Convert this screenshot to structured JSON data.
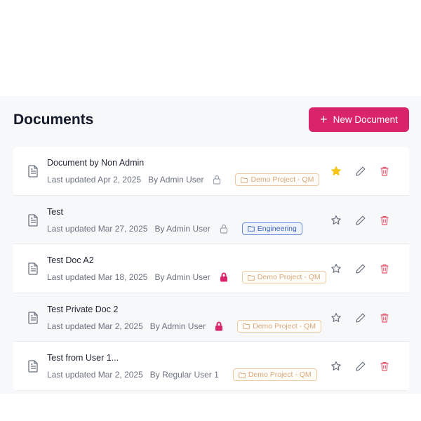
{
  "header": {
    "title": "Documents",
    "new_button_label": "New Document"
  },
  "colors": {
    "brand": "#d9246b",
    "star_active": "#f5c518",
    "delete": "#e5566f"
  },
  "documents": [
    {
      "title": "Document by Non Admin",
      "updated": "Last updated Apr 2, 2025",
      "author": "By Admin User",
      "lock": "outline",
      "project": "Demo Project - QM",
      "tag_style": "orange",
      "starred": true
    },
    {
      "title": "Test",
      "updated": "Last updated Mar 27, 2025",
      "author": "By Admin User",
      "lock": "outline",
      "project": "Engineering",
      "tag_style": "blue",
      "starred": false
    },
    {
      "title": "Test Doc A2",
      "updated": "Last updated Mar 18, 2025",
      "author": "By Admin User",
      "lock": "filled",
      "project": "Demo Project - QM",
      "tag_style": "orange",
      "starred": false
    },
    {
      "title": "Test Private Doc 2",
      "updated": "Last updated Mar 2, 2025",
      "author": "By Admin User",
      "lock": "filled",
      "project": "Demo Project - QM",
      "tag_style": "orange",
      "starred": false
    },
    {
      "title": "Test from User 1...",
      "updated": "Last updated Mar 2, 2025",
      "author": "By Regular User 1",
      "lock": "none",
      "project": "Demo Project - QM",
      "tag_style": "orange",
      "starred": false
    }
  ]
}
